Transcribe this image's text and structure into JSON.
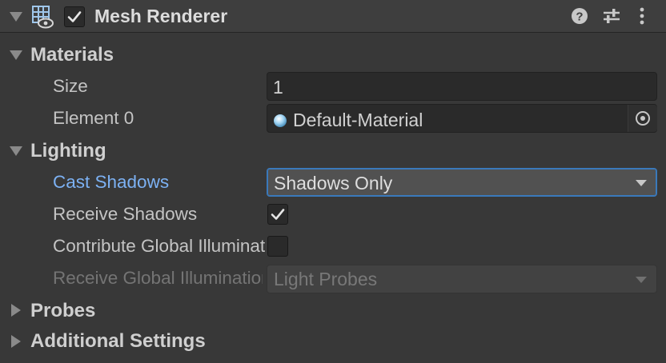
{
  "component": {
    "title": "Mesh Renderer",
    "enabled": true,
    "icons": [
      "collapse-arrow-icon",
      "mesh-renderer-icon",
      "help-icon",
      "preset-icon",
      "kebab-menu-icon"
    ]
  },
  "sections": {
    "materials": {
      "label": "Materials",
      "size_label": "Size",
      "size_value": "1",
      "element0_label": "Element 0",
      "element0_value": "Default-Material"
    },
    "lighting": {
      "label": "Lighting",
      "cast_shadows_label": "Cast Shadows",
      "cast_shadows_value": "Shadows Only",
      "receive_shadows_label": "Receive Shadows",
      "receive_shadows_checked": true,
      "contribute_gi_label": "Contribute Global Illumination",
      "contribute_gi_checked": false,
      "receive_gi_label": "Receive Global Illumination",
      "receive_gi_value": "Light Probes"
    },
    "probes": {
      "label": "Probes"
    },
    "additional": {
      "label": "Additional Settings"
    }
  },
  "colors": {
    "background": "#383838",
    "header": "#3e3e3e",
    "accent_label": "#7cb1f3",
    "focus_border": "#3a79bb"
  }
}
